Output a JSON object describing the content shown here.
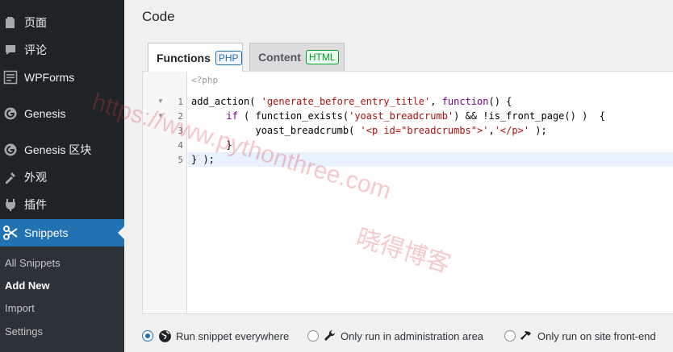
{
  "sidebar": {
    "items": [
      {
        "label": "页面",
        "icon": "page-icon"
      },
      {
        "label": "评论",
        "icon": "comment-icon"
      },
      {
        "label": "WPForms",
        "icon": "wpforms-icon"
      },
      {
        "label": "Genesis",
        "icon": "genesis-icon"
      },
      {
        "label": "Genesis 区块",
        "icon": "genesis-blocks-icon"
      },
      {
        "label": "外观",
        "icon": "appearance-icon"
      },
      {
        "label": "插件",
        "icon": "plugins-icon"
      },
      {
        "label": "Snippets",
        "icon": "snippets-scissors-icon"
      }
    ],
    "submenu": [
      "All Snippets",
      "Add New",
      "Import",
      "Settings"
    ],
    "current_submenu": "Add New"
  },
  "main": {
    "title": "Code",
    "tabs": [
      {
        "label": "Functions",
        "badge": "PHP"
      },
      {
        "label": "Content",
        "badge": "HTML"
      }
    ]
  },
  "editor": {
    "header_comment": "<?php",
    "line_numbers": [
      "1",
      "2",
      "3",
      "4",
      "5"
    ],
    "lines": [
      "add_action( 'generate_before_entry_title', function() {",
      "      if ( function_exists('yoast_breadcrumb') && !is_front_page() )  {",
      "           yoast_breadcrumb( '<p id=\"breadcrumbs\">','</p>' );",
      "      }",
      "} );"
    ]
  },
  "run_options": {
    "selected": "Run snippet everywhere",
    "options": [
      {
        "label": "Run snippet everywhere",
        "icon": "globe-icon"
      },
      {
        "label": "Only run in administration area",
        "icon": "wrench-icon"
      },
      {
        "label": "Only run on site front-end",
        "icon": "hammer-icon"
      }
    ]
  },
  "watermark": {
    "url": "https://www.pythonthree.com",
    "brand": "晓得博客"
  },
  "colors": {
    "sidebar_bg": "#1d2327",
    "accent": "#2271b1",
    "php_badge": "#2271b1",
    "html_badge": "#00a32a"
  }
}
